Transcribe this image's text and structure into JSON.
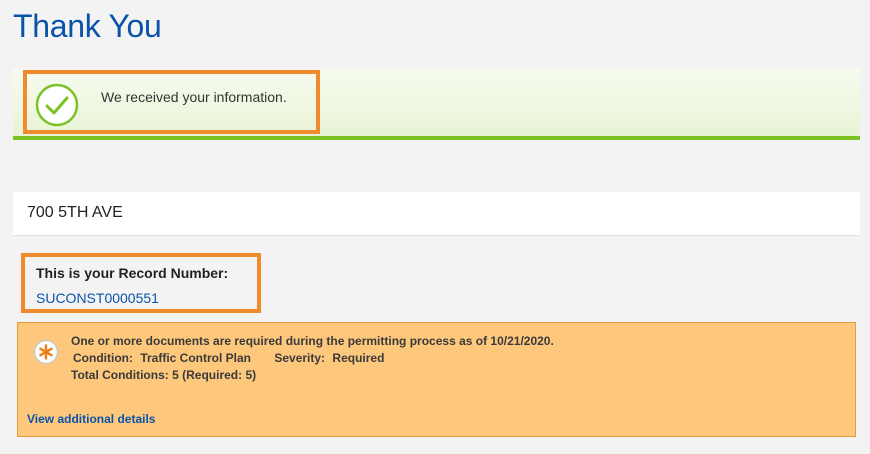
{
  "page": {
    "title": "Thank You"
  },
  "success": {
    "message": "We received your information.",
    "icon": "check-circle-icon",
    "accent_color": "#7cc225"
  },
  "address": {
    "text": "700 5TH AVE"
  },
  "record": {
    "label": "This is your Record Number:",
    "number": "SUCONST0000551"
  },
  "notice": {
    "icon": "asterisk-warning-icon",
    "line1": "One or more documents are required during the permitting process as of 10/21/2020.",
    "condition_label": "Condition:",
    "condition_value": "Traffic Control Plan",
    "severity_label": "Severity:",
    "severity_value": "Required",
    "total_label": "Total Conditions: 5",
    "total_required": "(Required: 5)",
    "link_text": "View additional details",
    "background_color": "#fec87c"
  },
  "highlight_color": "#f08a2c"
}
